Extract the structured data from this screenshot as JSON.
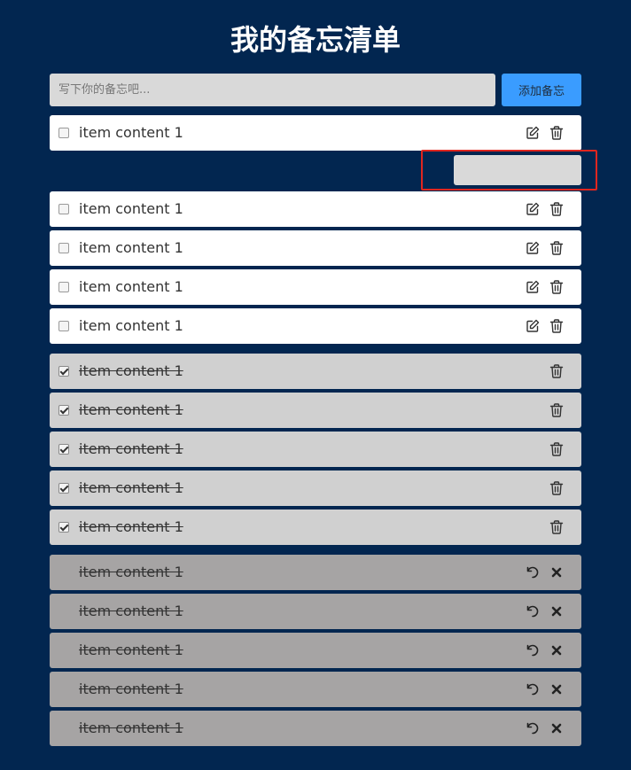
{
  "header": {
    "title": "我的备忘清单"
  },
  "add": {
    "placeholder": "写下你的备忘吧...",
    "button_label": "添加备忘"
  },
  "edit": {
    "value": ""
  },
  "active_items": [
    {
      "text": "item content 1"
    },
    {
      "text": "item content 1"
    },
    {
      "text": "item content 1"
    },
    {
      "text": "item content 1"
    },
    {
      "text": "item content 1"
    }
  ],
  "done_items": [
    {
      "text": "item content 1"
    },
    {
      "text": "item content 1"
    },
    {
      "text": "item content 1"
    },
    {
      "text": "item content 1"
    },
    {
      "text": "item content 1"
    }
  ],
  "deleted_items": [
    {
      "text": "item content 1"
    },
    {
      "text": "item content 1"
    },
    {
      "text": "item content 1"
    },
    {
      "text": "item content 1"
    },
    {
      "text": "item content 1"
    }
  ],
  "colors": {
    "background": "#022650",
    "add_button": "#3a9cff",
    "highlight": "#e0261f"
  },
  "icons": {
    "edit": "edit-icon",
    "delete": "trash-icon",
    "restore": "undo-icon",
    "remove": "close-icon"
  }
}
